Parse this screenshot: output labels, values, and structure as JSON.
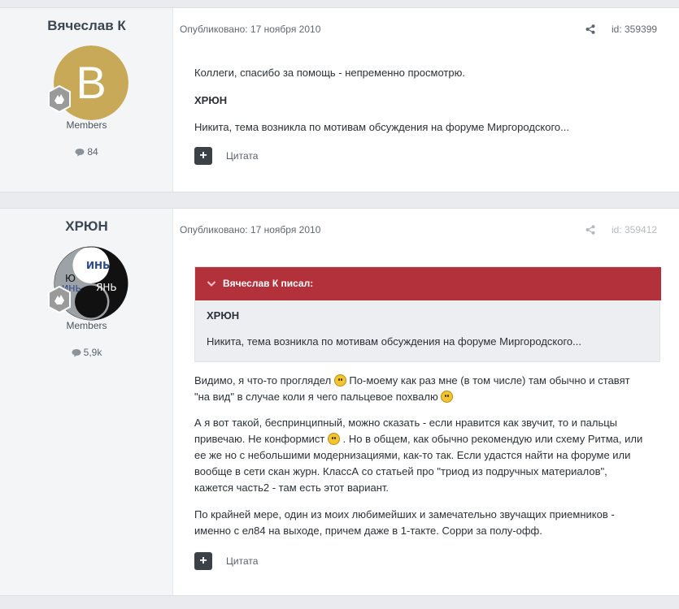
{
  "posts": [
    {
      "author": "Вячеслав К",
      "avatar_letter": "B",
      "group": "Members",
      "post_count": "84",
      "published": "Опубликовано: 17 ноября 2010",
      "id_label": "id: 359399",
      "lines": [
        "Коллеги, спасибо за помощь - непременно просмотрю.",
        "ХРЮН",
        "Никита, тема возникла по мотивам обсуждения на форуме Миргородского..."
      ],
      "quote_button": "Цитата"
    },
    {
      "author": "ХРЮН",
      "avatar_text": {
        "yin": "ИНЬ",
        "yang": "ЯНЬ",
        "yu": "Ю",
        "small": "ИНЬ"
      },
      "group": "Members",
      "post_count": "5,9k",
      "published": "Опубликовано: 17 ноября 2010",
      "id_label": "id: 359412",
      "quote": {
        "header": "Вячеслав К писал:",
        "author": "ХРЮН",
        "text": "Никита, тема возникла по мотивам обсуждения на форуме Миргородского..."
      },
      "para1": {
        "a": "Видимо, я что-то проглядел",
        "b": "По-моему как раз мне (в том числе) там обычно и ставят",
        "c": "\"на вид\" в случае коли я чего пальцевое похвалю"
      },
      "para2": {
        "a": "А я вот такой, беспринципный, можно сказать - если нравится как звучит, то и пальцы",
        "b": "привечаю. Не конформист",
        "c": ". Но в общем, как обычно рекомендую или схему Ритма, или",
        "d": "ее же но с небольшими модернизациями, как-то так. Если удастся найти на форуме или",
        "e": "вообще в сети скан журн. КлассА со статьей про \"триод из подручных материалов\",",
        "f": "кажется часть2 - там есть этот вариант."
      },
      "para3": {
        "a": "По крайней мере, один из моих любимейших и замечательно звучащих приемников -",
        "b": "именно с ел84 на выходе, причем даже в 1-такте. Сорри за полу-офф."
      },
      "quote_button": "Цитата"
    }
  ],
  "colors": {
    "quote_header": "#b3313b",
    "avatar_gold": "#c8a957",
    "page_bg": "#e9ebee"
  }
}
